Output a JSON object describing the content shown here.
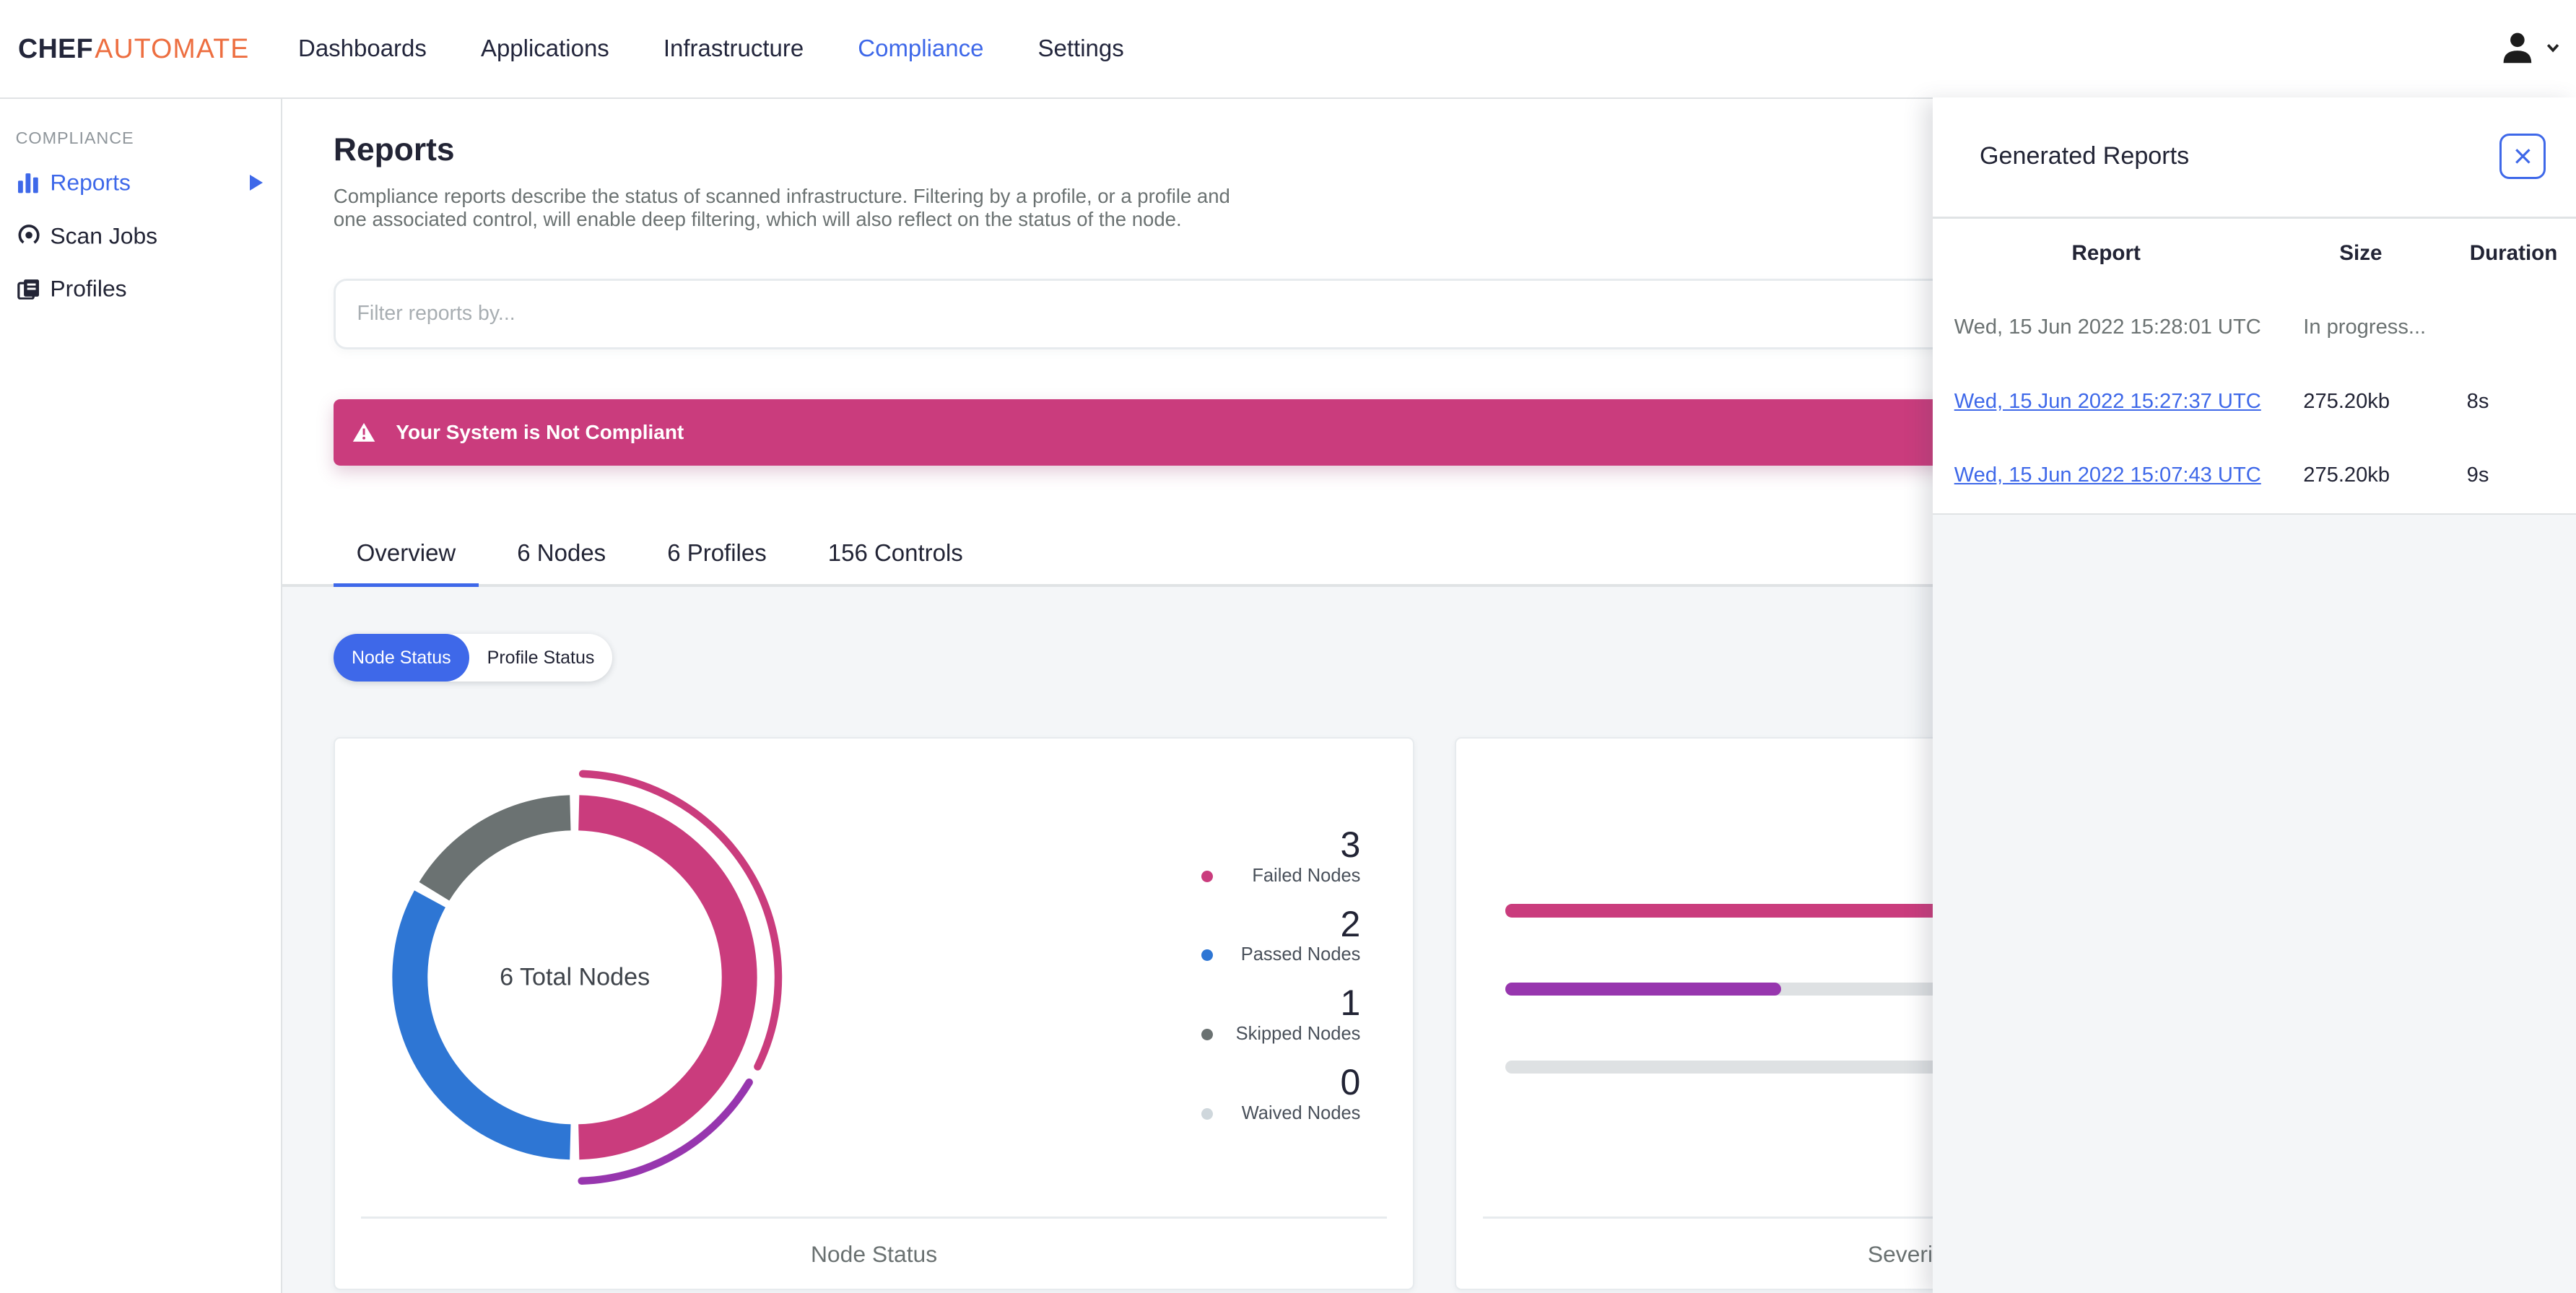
{
  "brand": {
    "name_bold": "CHEF",
    "name_light": "AUTOMATE"
  },
  "nav": {
    "items": [
      "Dashboards",
      "Applications",
      "Infrastructure",
      "Compliance",
      "Settings"
    ],
    "active_item": "Compliance"
  },
  "sidebar": {
    "section_label": "COMPLIANCE",
    "items": [
      {
        "label": "Reports",
        "active": true
      },
      {
        "label": "Scan Jobs",
        "active": false
      },
      {
        "label": "Profiles",
        "active": false
      }
    ]
  },
  "page": {
    "title": "Reports",
    "description": [
      "Compliance reports describe the status of scanned infrastructure. Filtering by a profile, or a profile and",
      "one associated control, will enable deep filtering, which will also reflect on the status of the node."
    ],
    "filter_placeholder": "Filter reports by...",
    "alert_text": "Your System is Not Compliant"
  },
  "tabs": [
    {
      "label": "Overview",
      "active": true
    },
    {
      "label": "6 Nodes",
      "active": false
    },
    {
      "label": "6 Profiles",
      "active": false
    },
    {
      "label": "156 Controls",
      "active": false
    }
  ],
  "status_toggle": [
    {
      "label": "Node Status",
      "active": true
    },
    {
      "label": "Profile Status",
      "active": false
    }
  ],
  "generated_reports_panel": {
    "title": "Generated Reports",
    "columns": [
      "Report",
      "Size",
      "Duration"
    ],
    "rows": [
      {
        "report": "Wed, 15 Jun 2022 15:28:01 UTC",
        "size": "In progress...",
        "duration": "",
        "is_link": false
      },
      {
        "report": "Wed, 15 Jun 2022 15:27:37 UTC",
        "size": "275.20kb",
        "duration": "8s",
        "is_link": true
      },
      {
        "report": "Wed, 15 Jun 2022 15:07:43 UTC",
        "size": "275.20kb",
        "duration": "9s",
        "is_link": true
      }
    ]
  },
  "chart_data": [
    {
      "type": "donut",
      "title": "Node Status",
      "center_label": "6 Total Nodes",
      "labels": [
        "Failed Nodes",
        "Passed Nodes",
        "Skipped Nodes",
        "Waived Nodes"
      ],
      "values": [
        3,
        2,
        1,
        0
      ],
      "colors": [
        "#ca3c7d",
        "#2e76d4",
        "#6b7272",
        "#cfd7dc"
      ],
      "outer_arcs": [
        {
          "from_deg": 2.3,
          "to_deg": 116,
          "color": "#ca3c7d"
        },
        {
          "from_deg": 121,
          "to_deg": 178,
          "color": "#9736ae"
        }
      ],
      "legend_position": "right"
    },
    {
      "type": "bar",
      "title": "Severity",
      "orientation": "horizontal",
      "track_color": "#dee1e3",
      "bars": [
        {
          "fill_pct": 100,
          "color": "#ca3c7d"
        },
        {
          "fill_pct": 34,
          "color": "#9736ae"
        },
        {
          "fill_pct": 0,
          "color": "#dee1e3"
        }
      ]
    }
  ],
  "colors": {
    "accent_blue": "#3e68e9",
    "alert_pink": "#ca3c7d",
    "purple": "#9736ae",
    "passed_blue": "#2e76d4",
    "muted_gray": "#6b7272",
    "waived_gray": "#cfd7dc",
    "background": "#f4f6f8",
    "brand_orange": "#ed6e40"
  }
}
